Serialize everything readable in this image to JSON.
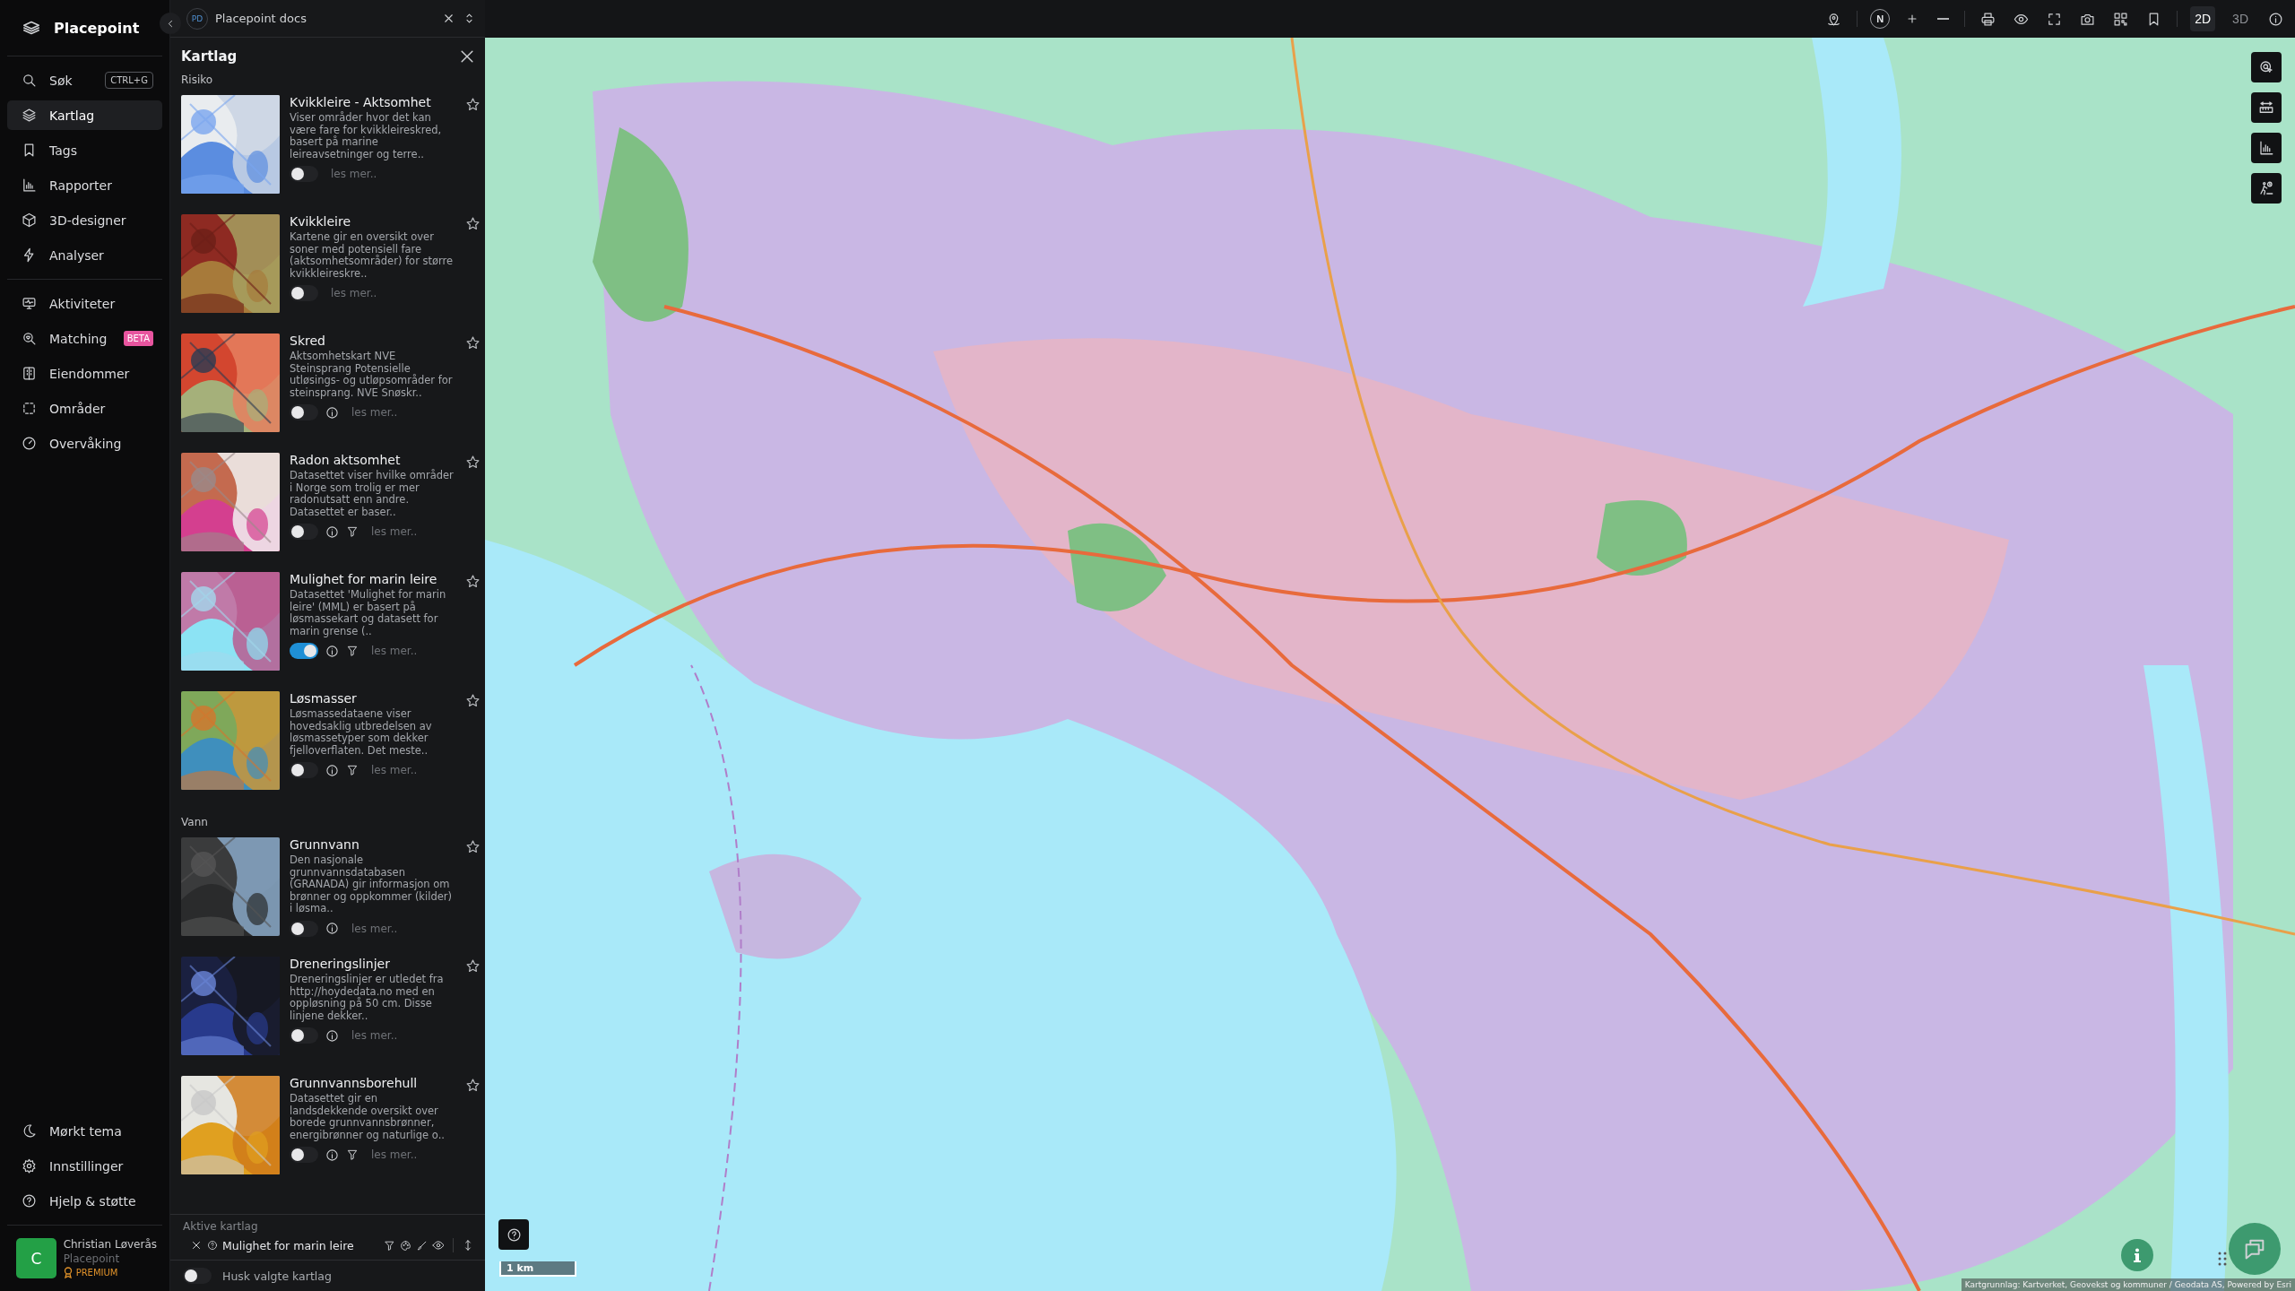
{
  "app": {
    "name": "Placepoint"
  },
  "nav": {
    "main": [
      {
        "label": "Søk",
        "shortcut": "CTRL+G",
        "selected": false
      },
      {
        "label": "Kartlag",
        "selected": true
      },
      {
        "label": "Tags",
        "selected": false
      },
      {
        "label": "Rapporter",
        "selected": false
      },
      {
        "label": "3D-designer",
        "selected": false
      },
      {
        "label": "Analyser",
        "selected": false
      }
    ],
    "secondary": [
      {
        "label": "Aktiviteter",
        "selected": false
      },
      {
        "label": "Matching",
        "badge": "BETA",
        "selected": false
      },
      {
        "label": "Eiendommer",
        "selected": false
      },
      {
        "label": "Områder",
        "selected": false
      },
      {
        "label": "Overvåking",
        "selected": false
      }
    ],
    "footer": [
      {
        "label": "Mørkt tema"
      },
      {
        "label": "Innstillinger"
      },
      {
        "label": "Hjelp & støtte"
      }
    ]
  },
  "user": {
    "initial": "C",
    "name": "Christian Løverås",
    "org": "Placepoint",
    "plan": "PREMIUM"
  },
  "workspace": {
    "initials": "PD",
    "name": "Placepoint docs"
  },
  "panel": {
    "title": "Kartlag",
    "sections": [
      {
        "title": "Risiko",
        "layers": [
          {
            "title": "Kvikkleire - Aktsomhet",
            "description": "Viser områder hvor det kan være fare for kvikkleireskred, basert på marine leireavsetninger og terre..",
            "on": false,
            "info": false,
            "filter": false,
            "link": "les mer.."
          },
          {
            "title": "Kvikkleire",
            "description": "Kartene gir en oversikt over soner med potensiell fare (aktsomhetsområder) for større kvikkleireskre..",
            "on": false,
            "info": false,
            "filter": false,
            "link": "les mer.."
          },
          {
            "title": "Skred",
            "description": "Aktsomhetskart NVE Steinsprang Potensielle utløsings- og utløpsområder for steinsprang. NVE Snøskr..",
            "on": false,
            "info": true,
            "filter": false,
            "link": "les mer.."
          },
          {
            "title": "Radon aktsomhet",
            "description": "Datasettet viser hvilke områder i Norge som trolig er mer radonutsatt enn andre. Datasettet er baser..",
            "on": false,
            "info": true,
            "filter": true,
            "link": "les mer.."
          },
          {
            "title": "Mulighet for marin leire",
            "description": "Datasettet 'Mulighet for marin leire' (MML) er basert på løsmassekart og datasett for marin grense (..",
            "on": true,
            "info": true,
            "filter": true,
            "link": "les mer.."
          },
          {
            "title": "Løsmasser",
            "description": "Løsmassedataene viser hovedsaklig utbredelsen av løsmassetyper som dekker fjelloverflaten. Det meste..",
            "on": false,
            "info": true,
            "filter": true,
            "link": "les mer.."
          }
        ]
      },
      {
        "title": "Vann",
        "layers": [
          {
            "title": "Grunnvann",
            "description": "Den nasjonale grunnvannsdatabasen (GRANADA) gir informasjon om brønner og oppkommer (kilder) i løsma..",
            "on": false,
            "info": true,
            "filter": false,
            "link": "les mer.."
          },
          {
            "title": "Dreneringslinjer",
            "description": "Dreneringslinjer er utledet fra http://hoydedata.no med en oppløsning på 50 cm. Disse linjene dekker..",
            "on": false,
            "info": true,
            "filter": false,
            "link": "les mer.."
          },
          {
            "title": "Grunnvannsborehull",
            "description": "Datasettet gir en landsdekkende oversikt over borede grunnvannsbrønner, energibrønner og naturlige o..",
            "on": false,
            "info": true,
            "filter": true,
            "link": "les mer.."
          }
        ]
      }
    ]
  },
  "active_layers": {
    "title": "Aktive kartlag",
    "items": [
      {
        "name": "Mulighet for marin leire"
      }
    ]
  },
  "remember": {
    "label": "Husk valgte kartlag",
    "on": false
  },
  "map_toolbar": {
    "compass": "N",
    "view_modes": [
      {
        "label": "2D",
        "selected": true
      },
      {
        "label": "3D",
        "selected": false
      }
    ]
  },
  "map": {
    "scale": "1 km",
    "attribution": "Kartgrunnlag: Kartverket, Geovekst og kommuner / Geodata AS, Powered by Esri"
  }
}
